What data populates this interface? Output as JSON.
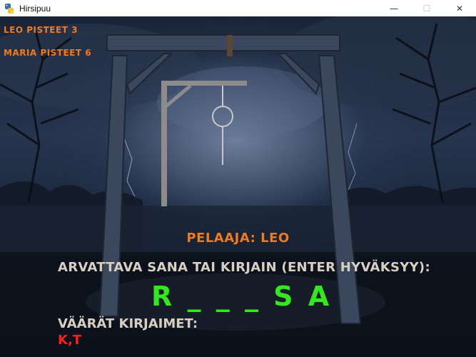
{
  "window": {
    "title": "Hirsipuu",
    "minimize": "—",
    "maximize": "☐",
    "close": "✕"
  },
  "scores": [
    {
      "text": "LEO PISTEET 3"
    },
    {
      "text": "MARIA PISTEET 6"
    }
  ],
  "player_line": "PELAAJA: LEO",
  "prompt": "ARVATTAVA SANA TAI KIRJAIN (ENTER HYVÄKSYY):",
  "word_display": "R _ _ _ S A",
  "wrong_label": "VÄÄRÄT KIRJAIMET:",
  "wrong_letters": "K,T",
  "colors": {
    "score": "#f07a1e",
    "player": "#f07a1e",
    "prompt": "#d8cfc3",
    "word": "#33e81f",
    "wrong_letters": "#ff1d1d",
    "gallows": "#8c8c8c",
    "noose": "#c8c8c8"
  }
}
